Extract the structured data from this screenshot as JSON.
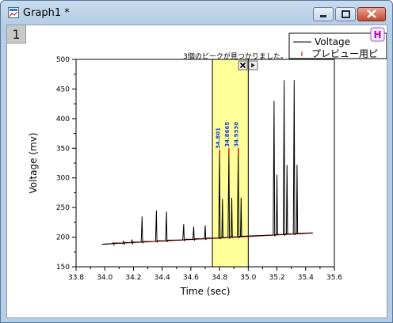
{
  "window": {
    "title": "Graph1 *",
    "layer_number": "1",
    "h_button": "H"
  },
  "legend": {
    "entries": [
      {
        "label": "Voltage",
        "color": "#000000"
      },
      {
        "label": "プレビュー用ピ",
        "color": "#cc0000"
      }
    ]
  },
  "status": {
    "message": "3個のピークが見つかりました。"
  },
  "chart_data": {
    "type": "line",
    "xlabel": "Time (sec)",
    "ylabel": "Voltage (mv)",
    "xlim": [
      33.8,
      35.6
    ],
    "ylim": [
      150,
      500
    ],
    "xticks": [
      33.8,
      34.0,
      34.2,
      34.4,
      34.6,
      34.8,
      35.0,
      35.2,
      35.4,
      35.6
    ],
    "yticks": [
      150,
      200,
      250,
      300,
      350,
      400,
      450,
      500
    ],
    "xtick_labels": [
      "33.8",
      "34.0",
      "34.2",
      "34.4",
      "34.6",
      "34.8",
      "35.0",
      "35.2",
      "35.4",
      "35.6"
    ],
    "ytick_labels": [
      "150",
      "200",
      "250",
      "300",
      "350",
      "400",
      "450",
      "500"
    ],
    "highlight_region": [
      34.75,
      35.0
    ],
    "baseline": {
      "x": [
        33.98,
        35.45
      ],
      "y": [
        188,
        207
      ]
    },
    "series": [
      {
        "name": "Voltage",
        "peaks": [
          {
            "x": 34.06,
            "y": 191
          },
          {
            "x": 34.13,
            "y": 193
          },
          {
            "x": 34.19,
            "y": 196
          },
          {
            "x": 34.26,
            "y": 235
          },
          {
            "x": 34.36,
            "y": 245
          },
          {
            "x": 34.43,
            "y": 243
          },
          {
            "x": 34.55,
            "y": 222
          },
          {
            "x": 34.62,
            "y": 218
          },
          {
            "x": 34.7,
            "y": 220
          },
          {
            "x": 34.8,
            "y": 345
          },
          {
            "x": 34.865,
            "y": 348
          },
          {
            "x": 34.93,
            "y": 348
          },
          {
            "x": 35.18,
            "y": 430
          },
          {
            "x": 35.25,
            "y": 465
          },
          {
            "x": 35.32,
            "y": 465
          }
        ]
      }
    ],
    "peak_labels": [
      {
        "x": 34.801,
        "y": 345,
        "text": "34.801"
      },
      {
        "x": 34.865,
        "y": 348,
        "text": "34.8665"
      },
      {
        "x": 34.93,
        "y": 348,
        "text": "34.9330"
      }
    ]
  }
}
